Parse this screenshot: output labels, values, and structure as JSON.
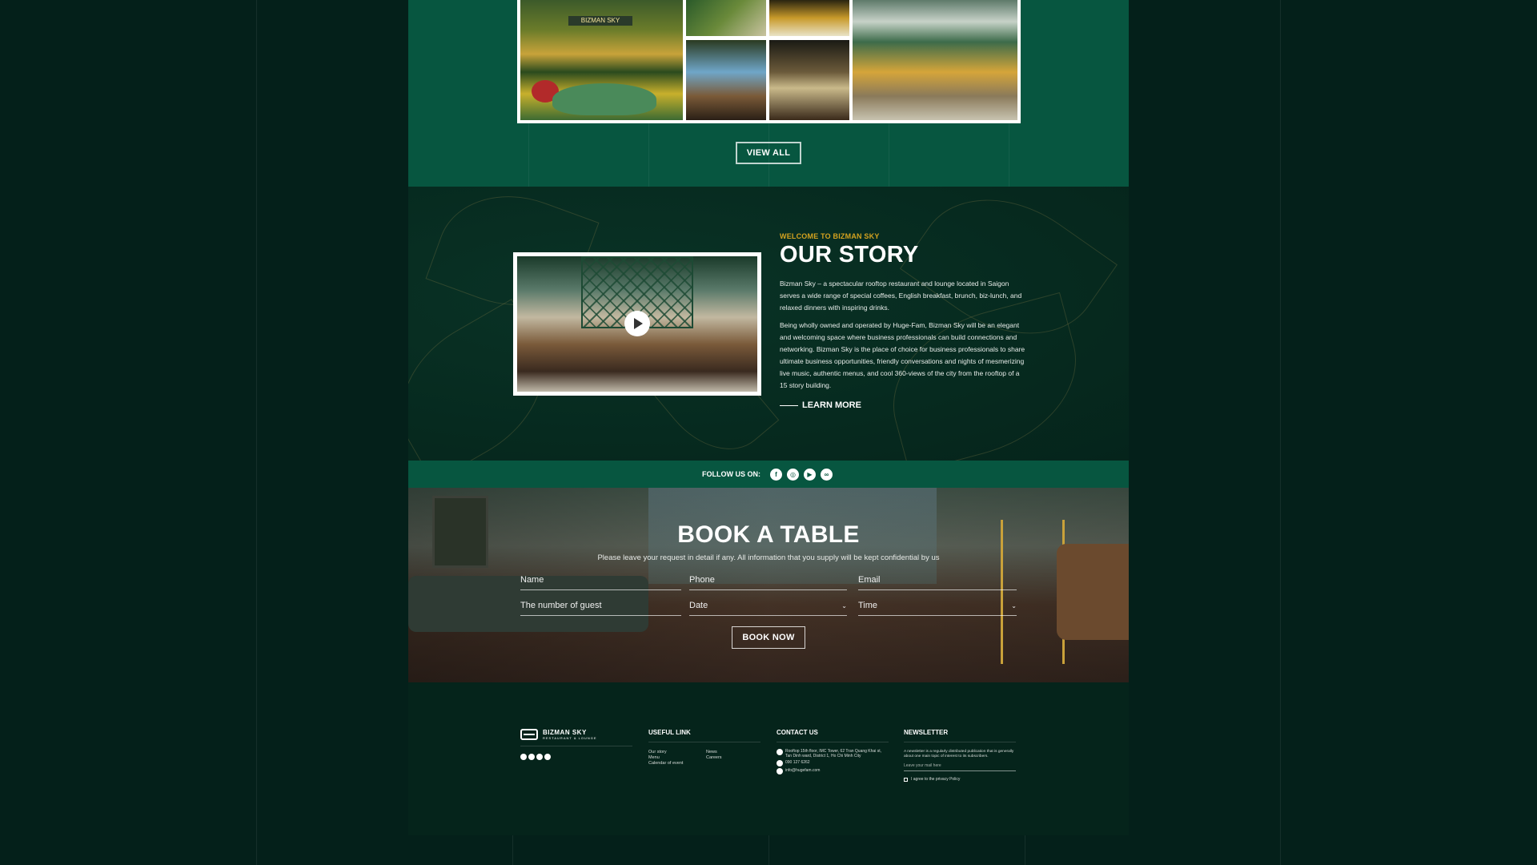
{
  "gallery": {
    "sign_text": "BIZMAN SKY",
    "view_all_label": "VIEW ALL"
  },
  "story": {
    "eyebrow": "WELCOME TO BIZMAN SKY",
    "title": "OUR STORY",
    "paragraph_1": "Bizman Sky – a spectacular rooftop restaurant and lounge located in Saigon serves a wide range of special coffees, English breakfast, brunch, biz-lunch, and relaxed dinners with inspiring drinks.",
    "paragraph_2": "Being wholly owned and operated by Huge-Fam, Bizman Sky will be an elegant and welcoming space where business professionals can build connections and networking. Bizman Sky is the place of choice for business professionals to share ultimate business opportunities, friendly conversations and nights of mesmerizing live music, authentic menus, and cool 360-views of the city from the rooftop of a 15 story building.",
    "learn_more_label": "LEARN MORE"
  },
  "follow": {
    "label": "FOLLOW US ON:",
    "icons": [
      "facebook-icon",
      "instagram-icon",
      "youtube-icon",
      "tripadvisor-icon"
    ]
  },
  "booking": {
    "title": "BOOK A TABLE",
    "subtitle": "Please leave your request in detail if any. All information that you supply will be kept confidential by us",
    "fields": {
      "name": "Name",
      "phone": "Phone",
      "email": "Email",
      "guests": "The number of guest",
      "date": "Date",
      "time": "Time"
    },
    "submit_label": "BOOK NOW"
  },
  "footer": {
    "logo_text": "BIZMAN SKY",
    "logo_subtext": "RESTAURANT & LOUNGE",
    "useful_link": {
      "heading": "USEFUL LINK",
      "links": [
        "Our story",
        "News",
        "Menu",
        "Careers",
        "Calendar of event"
      ]
    },
    "contact": {
      "heading": "CONTACT US",
      "address": "Rooftop 15th floor, IMC Tower, 62 Tran Quang Khai st, Tan Dinh ward, District 1, Ho Chi Minh City",
      "phone": "090 127 6262",
      "email": "info@hugefam.com"
    },
    "newsletter": {
      "heading": "NEWSLETTER",
      "description": "A newsletter is a regularly distributed publication that is generally about one main topic of interest to its subscribers.",
      "placeholder": "Leave your mail here",
      "agree_label": "I agree to the privacy Policy"
    }
  }
}
